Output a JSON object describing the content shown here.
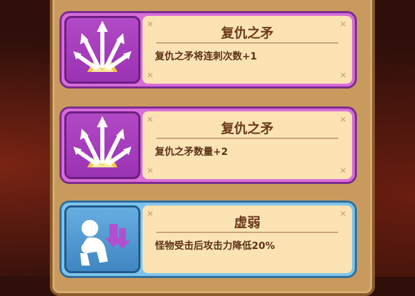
{
  "cards": [
    {
      "title": "复仇之矛",
      "description": "复仇之矛将连刺次数+1",
      "icon": "spear-burst-icon",
      "color": "#d86cd8"
    },
    {
      "title": "复仇之矛",
      "description": "复仇之矛数量+2",
      "icon": "spear-burst-icon",
      "color": "#d86cd8"
    },
    {
      "title": "虚弱",
      "description": "怪物受击后攻击力降低20%",
      "icon": "weakened-figure-icon",
      "color": "#7ec4ea"
    }
  ]
}
